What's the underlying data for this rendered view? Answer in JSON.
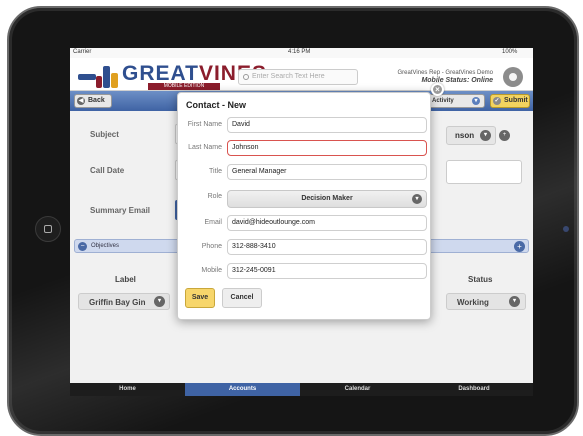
{
  "status_bar": {
    "carrier": "Carrier",
    "time": "4:16 PM",
    "battery": "100%"
  },
  "header": {
    "logo_word": "GREATVINES",
    "logo_edition": "MOBILE EDITION",
    "search_placeholder": "Enter Search Text Here",
    "rep_line": "GreatVines Rep - GreatVines Demo",
    "mobile_status": "Mobile Status: Online"
  },
  "toolbar": {
    "back_label": "Back",
    "activity_label": "Activity",
    "submit_label": "Submit"
  },
  "background_form": {
    "subject_label": "Subject",
    "call_date_label": "Call Date",
    "summary_email_label": "Summary Email",
    "contact_partial": "nson",
    "objectives_label": "Objectives",
    "col_label": "Label",
    "col_status": "Status",
    "row_label": "Griffin Bay Gin",
    "row_status": "Working"
  },
  "tabs": [
    "Home",
    "Accounts",
    "Calendar",
    "Dashboard"
  ],
  "modal": {
    "title": "Contact - New",
    "fields": {
      "first_name_label": "First Name",
      "first_name_value": "David",
      "last_name_label": "Last Name",
      "last_name_value": "Johnson",
      "title_label": "Title",
      "title_value": "General Manager",
      "role_label": "Role",
      "role_value": "Decision Maker",
      "email_label": "Email",
      "email_value": "david@hideoutlounge.com",
      "phone_label": "Phone",
      "phone_value": "312-888-3410",
      "mobile_label": "Mobile",
      "mobile_value": "312-245-0091"
    },
    "save_label": "Save",
    "cancel_label": "Cancel"
  },
  "colors": {
    "accent_blue": "#3f63a4",
    "save_yellow": "#f7d66b",
    "error_red": "#d9534f",
    "brand_red": "#8b1d2c"
  }
}
